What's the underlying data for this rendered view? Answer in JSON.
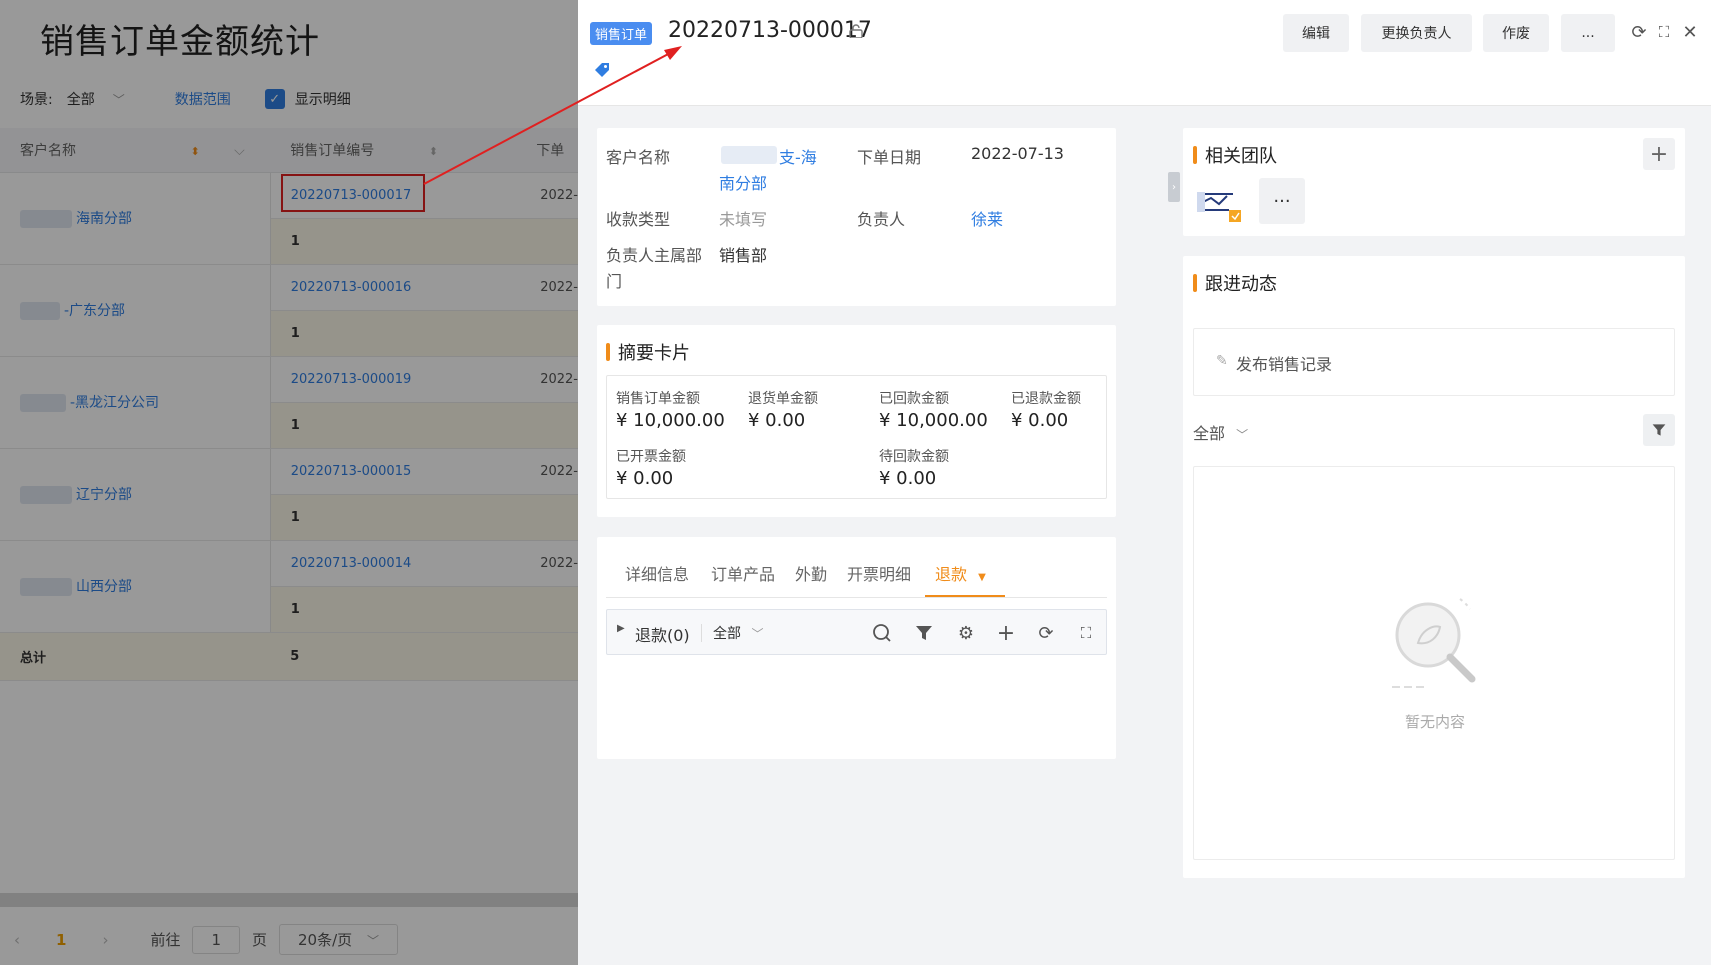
{
  "left": {
    "page_title": "销售订单金额统计",
    "filter": {
      "scene_label": "场景:",
      "scene_value": "全部",
      "data_range": "数据范围",
      "show_detail": "显示明细"
    },
    "columns": [
      "客户名称",
      "销售订单编号",
      "下单"
    ],
    "rows": [
      {
        "customer": "海南分部",
        "order": "20220713-000017",
        "count": "1",
        "date": "2022-"
      },
      {
        "customer": "-广东分部",
        "order": "20220713-000016",
        "count": "1",
        "date": "2022-"
      },
      {
        "customer": "-黑龙江分公司",
        "order": "20220713-000019",
        "count": "1",
        "date": "2022-"
      },
      {
        "customer": "辽宁分部",
        "order": "20220713-000015",
        "count": "1",
        "date": "2022-"
      },
      {
        "customer": "山西分部",
        "order": "20220713-000014",
        "count": "1",
        "date": "2022-"
      }
    ],
    "total_label": "总计",
    "total_value": "5",
    "pager": {
      "current": "1",
      "goto": "前往",
      "page_input": "1",
      "page_unit": "页",
      "page_size": "20条/页"
    }
  },
  "drawer": {
    "tag": "销售订单",
    "order_no": "20220713-000017",
    "buttons": {
      "edit": "编辑",
      "change_owner": "更换负责人",
      "void": "作废",
      "more": "..."
    },
    "basic": {
      "customer_label": "客户名称",
      "customer_value_1": "支-海",
      "customer_value_2": "南分部",
      "order_date_label": "下单日期",
      "order_date_value": "2022-07-13",
      "pay_type_label": "收款类型",
      "pay_type_value": "未填写",
      "owner_label": "负责人",
      "owner_value": "徐莱",
      "owner_dept_label_1": "负责人主属部",
      "owner_dept_label_2": "门",
      "owner_dept_value": "销售部"
    },
    "summary": {
      "title": "摘要卡片",
      "items": [
        {
          "label": "销售订单金额",
          "value": "¥ 10,000.00"
        },
        {
          "label": "退货单金额",
          "value": "¥ 0.00"
        },
        {
          "label": "已回款金额",
          "value": "¥ 10,000.00"
        },
        {
          "label": "已退款金额",
          "value": "¥ 0.00"
        },
        {
          "label": "已开票金额",
          "value": "¥ 0.00"
        },
        {
          "label": "待回款金额",
          "value": "¥ 0.00"
        }
      ]
    },
    "tabs": [
      "详细信息",
      "订单产品",
      "外勤",
      "开票明细",
      "退款"
    ],
    "refund_bar": {
      "title": "退款(0)",
      "filter": "全部"
    },
    "team": {
      "title": "相关团队",
      "more": "···"
    },
    "follow": {
      "title": "跟进动态",
      "post": "发布销售记录",
      "filter": "全部",
      "empty": "暂无内容"
    }
  }
}
